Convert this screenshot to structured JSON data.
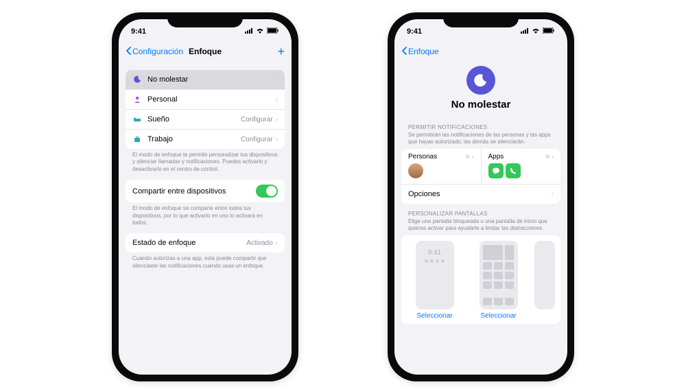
{
  "status": {
    "time": "9:41"
  },
  "phone1": {
    "back": "Configuración",
    "title": "Enfoque",
    "focus_modes": [
      {
        "label": "No molestar",
        "icon": "moon",
        "color": "#5856d6",
        "selected": true
      },
      {
        "label": "Personal",
        "icon": "person",
        "color": "#a855d6",
        "selected": false
      },
      {
        "label": "Sueño",
        "icon": "bed",
        "color": "#2aa8b0",
        "selected": false,
        "value": "Configurar"
      },
      {
        "label": "Trabajo",
        "icon": "work",
        "color": "#2aa8b0",
        "selected": false,
        "value": "Configurar"
      }
    ],
    "footer_modes": "El modo de enfoque te permite personalizar tus dispositivos y silenciar llamadas y notificaciones. Puedes activarlo y desactivarlo en el centro de control.",
    "share_label": "Compartir entre dispositivos",
    "footer_share": "El modo de enfoque se comparte entre todos tus dispositivos, por lo que activarlo en uno lo activará en todos.",
    "status_label": "Estado de enfoque",
    "status_value": "Activado",
    "footer_status": "Cuando autorizas a una app, esta puede compartir que silenciaste las notificaciones cuando usas un enfoque."
  },
  "phone2": {
    "back": "Enfoque",
    "hero_title": "No molestar",
    "allow_header": "PERMITIR NOTIFICACIONES",
    "allow_sub": "Se permitirán las notificaciones de las personas y las apps que hayas autorizado; las demás se silenciarán.",
    "people_label": "Personas",
    "apps_label": "Apps",
    "options_label": "Opciones",
    "screens_header": "PERSONALIZAR PANTALLAS",
    "screens_sub": "Elige una pantalla bloqueada o una pantalla de inicio que quieras activar para ayudarte a limitar las distracciones.",
    "select_label": "Seleccionar",
    "preview_time": "9:41"
  }
}
